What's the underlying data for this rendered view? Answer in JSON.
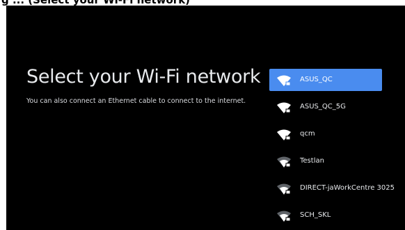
{
  "caption": "g ... (Select your Wi-Fi network)",
  "setup": {
    "title": "Select your Wi-Fi network",
    "subtitle": "You can also connect an Ethernet cable to connect to the internet."
  },
  "networks": [
    {
      "ssid": "ASUS_QC",
      "selected": true,
      "icon": "wifi-locked-icon"
    },
    {
      "ssid": "ASUS_QC_5G",
      "selected": false,
      "icon": "wifi-locked-icon"
    },
    {
      "ssid": "qcm",
      "selected": false,
      "icon": "wifi-locked-icon"
    },
    {
      "ssid": "Testlan",
      "selected": false,
      "icon": "wifi-locked-icon"
    },
    {
      "ssid": "DIRECT-jaWorkCentre 3025",
      "selected": false,
      "icon": "wifi-locked-icon"
    },
    {
      "ssid": "SCH_SKL",
      "selected": false,
      "icon": "wifi-locked-icon"
    }
  ],
  "colors": {
    "background": "#000000",
    "accent": "#4a8cef",
    "text": "#e8eaed"
  }
}
